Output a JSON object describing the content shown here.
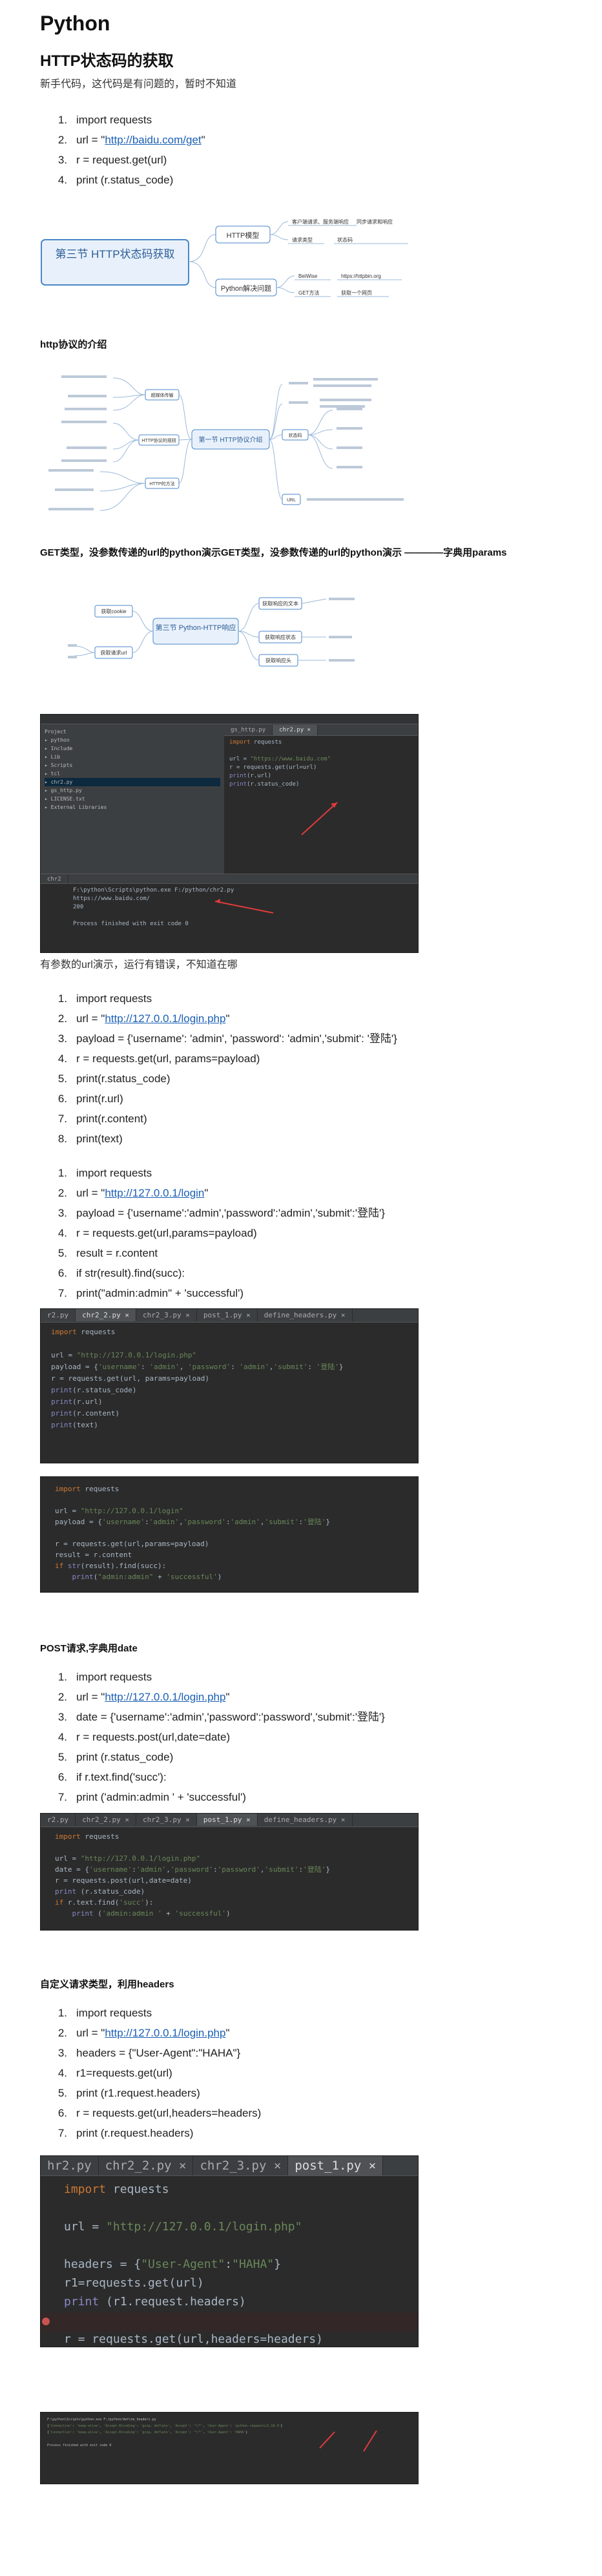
{
  "title": "Python",
  "subtitle": "HTTP状态码的获取",
  "intro": "新手代码，这代码是有问题的，暂时不知道",
  "list1": [
    {
      "n": "1.",
      "text": "import requests"
    },
    {
      "n": "2.",
      "pre": "url = \"",
      "link": "http://baidu.com/get",
      "post": "\""
    },
    {
      "n": "3.",
      "text": "r = request.get(url)"
    },
    {
      "n": "4.",
      "text": "print (r.status_code)"
    }
  ],
  "mindmap1": {
    "center": "第三节 HTTP状态码获取",
    "branches": [
      "HTTP模型",
      "Python解决问题"
    ],
    "leaves": [
      "客户端请求、服务端响应",
      "请求类型",
      "状态码",
      "同步请求和响应",
      "BeiWise",
      "https://httpbin.org",
      "GET方法",
      "获取一个网页"
    ]
  },
  "section_http": "http协议的介绍",
  "mindmap2": {
    "center": "第一节 HTTP协议介绍",
    "branches": [
      "超媒体传输",
      "HTTP协议的规则",
      "HTTP的方法",
      "状态码",
      "URL"
    ]
  },
  "section_get": "GET类型，没参数传递的url的python演示GET类型，没参数传递的url的python演示 ————字典用params",
  "mindmap3": {
    "center": "第三节 Python-HTTP响应",
    "branches": [
      "获取cookie",
      "获取请求url",
      "获取响应的文本",
      "获取响应状态",
      "获取响应头"
    ]
  },
  "ide1": {
    "tabs": [
      "gs_http.py",
      "chr2.py"
    ],
    "project": [
      "Project",
      "python",
      "Include",
      "Lib",
      "Scripts",
      "tcl",
      "chr2.py",
      "gs_http.py",
      "LICENSE.txt",
      "External Libraries"
    ],
    "code": [
      "import requests",
      "",
      "url = \"https://www.baidu.com\"",
      "r = requests.get(url=url)",
      "print(r.url)",
      "print(r.status_code)"
    ],
    "run_label": "chr2",
    "console": [
      "F:\\python\\Scripts\\python.exe F:/python/chr2.py",
      "https://www.baidu.com/",
      "200",
      "",
      "Process finished with exit code 0"
    ]
  },
  "note1": "有参数的url演示，运行有错误，不知道在哪",
  "list2": [
    {
      "n": "1.",
      "text": "import requests"
    },
    {
      "n": "2.",
      "pre": "url = \"",
      "link": "http://127.0.0.1/login.php",
      "post": "\""
    },
    {
      "n": "3.",
      "text": "payload = {'username': 'admin', 'password': 'admin','submit': '登陆'}"
    },
    {
      "n": "4.",
      "text": "r = requests.get(url, params=payload)"
    },
    {
      "n": "5.",
      "text": "print(r.status_code)"
    },
    {
      "n": "6.",
      "text": "print(r.url)"
    },
    {
      "n": "7.",
      "text": "print(r.content)"
    },
    {
      "n": "8.",
      "text": "print(text)"
    }
  ],
  "list3": [
    {
      "n": "1.",
      "text": "import requests"
    },
    {
      "n": "2.",
      "pre": "url = \"",
      "link": "http://127.0.0.1/login",
      "post": "\""
    },
    {
      "n": "3.",
      "text": "payload = {'username':'admin','password':'admin','submit':'登陆'}"
    },
    {
      "n": "4.",
      "text": "r = requests.get(url,params=payload)"
    },
    {
      "n": "5.",
      "text": "result = r.content"
    },
    {
      "n": "6.",
      "text": "if str(result).find(succ):"
    },
    {
      "n": "7.",
      "text": "print(\"admin:admin\" + 'successful')"
    }
  ],
  "ide2": {
    "tabs": [
      "r2.py",
      "chr2_2.py",
      "chr2_3.py",
      "post_1.py",
      "define_headers.py"
    ],
    "code": [
      "import requests",
      "",
      "url = \"http://127.0.0.1/login.php\"",
      "payload = {'username': 'admin', 'password': 'admin','submit': '登陆'}",
      "r = requests.get(url, params=payload)",
      "print(r.status_code)",
      "print(r.url)",
      "print(r.content)",
      "print(text)"
    ]
  },
  "ide3": {
    "code": [
      "import requests",
      "",
      "url = \"http://127.0.0.1/login\"",
      "payload = {'username':'admin','password':'admin','submit':'登陆'}",
      "",
      "r = requests.get(url,params=payload)",
      "result = r.content",
      "if str(result).find(succ):",
      "    print(\"admin:admin\" + 'successful')"
    ]
  },
  "section_post": "POST请求,字典用date",
  "list4": [
    {
      "n": "1.",
      "text": "import requests"
    },
    {
      "n": "2.",
      "pre": "url = \"",
      "link": "http://127.0.0.1/login.php",
      "post": "\""
    },
    {
      "n": "3.",
      "text": "date = {'username':'admin','password':'password','submit':'登陆'}"
    },
    {
      "n": "4.",
      "text": "r = requests.post(url,date=date)"
    },
    {
      "n": "5.",
      "text": "print (r.status_code)"
    },
    {
      "n": "6.",
      "text": "if r.text.find('succ'):"
    },
    {
      "n": "7.",
      "text": "print ('admin:admin ' + 'successful')"
    }
  ],
  "ide4": {
    "tabs": [
      "r2.py",
      "chr2_2.py",
      "chr2_3.py",
      "post_1.py",
      "define_headers.py"
    ],
    "code": [
      "import requests",
      "",
      "url = \"http://127.0.0.1/login.php\"",
      "date = {'username':'admin','password':'password','submit':'登陆'}",
      "r = requests.post(url,date=date)",
      "print (r.status_code)",
      "if r.text.find('succ'):",
      "    print ('admin:admin ' + 'successful')"
    ]
  },
  "section_headers": "自定义请求类型，利用headers",
  "list5": [
    {
      "n": "1.",
      "text": "import requests"
    },
    {
      "n": "2.",
      "pre": "url = \"",
      "link": "http://127.0.0.1/login.php",
      "post": "\""
    },
    {
      "n": "3.",
      "text": "headers = {\"User-Agent\":\"HAHA\"}"
    },
    {
      "n": "4.",
      "text": "r1=requests.get(url)"
    },
    {
      "n": "5.",
      "text": "print (r1.request.headers)"
    },
    {
      "n": "6.",
      "text": "r = requests.get(url,headers=headers)"
    },
    {
      "n": "7.",
      "text": "print (r.request.headers)"
    }
  ],
  "ide5": {
    "tabs": [
      "hr2.py",
      "chr2_2.py",
      "chr2_3.py",
      "post_1.py"
    ],
    "code": [
      "import requests",
      "",
      "url = \"http://127.0.0.1/login.php\"",
      "",
      "headers = {\"User-Agent\":\"HAHA\"}",
      "r1=requests.get(url)",
      "print (r1.request.headers)",
      "",
      "r = requests.get(url,headers=headers)",
      "print (r.request.headers)"
    ]
  },
  "ide6": {
    "console": [
      "F:\\python\\Scripts\\python.exe F:/python/define_headers.py",
      "{'Connection': 'keep-alive', 'Accept-Encoding': 'gzip, deflate', 'Accept': '*/*', 'User-Agent': 'python-requests/2.18.4'}",
      "{'Connection': 'keep-alive', 'Accept-Encoding': 'gzip, deflate', 'Accept': '*/*', 'User-Agent': 'HAHA'}",
      "",
      "Process finished with exit code 0"
    ]
  }
}
